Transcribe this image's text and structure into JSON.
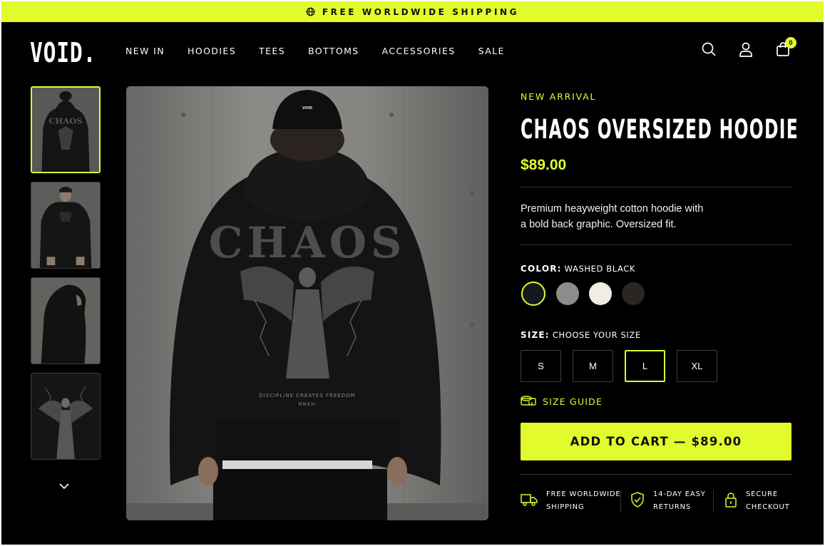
{
  "announcement": {
    "text": "FREE WORLDWIDE SHIPPING",
    "icon": "globe-icon"
  },
  "header": {
    "logo": "VOID.",
    "nav": [
      "NEW IN",
      "HOODIES",
      "TEES",
      "BOTTOMS",
      "ACCESSORIES",
      "SALE"
    ],
    "icons": [
      "search-icon",
      "user-icon",
      "bag-icon"
    ],
    "cart_count": "0"
  },
  "gallery": {
    "thumbnails": [
      "hoodie-back-view",
      "hoodie-front-view",
      "hoodie-side-view",
      "graphic-close-up"
    ],
    "main_graphic": {
      "headline": "CHAOS",
      "tagline": "DISCIPLINE CREATES FREEDOM",
      "year": "MMXXI",
      "cap_label": "VOID"
    }
  },
  "product": {
    "eyebrow": "NEW ARRIVAL",
    "title": "CHAOS OVERSIZED HOODIE",
    "price": "$89.00",
    "description_line1": "Premium heayweight cotton hoodie with",
    "description_line2": "a bold back graphic. Oversized fit.",
    "color_label": "COLOR:",
    "color_value": "WASHED BLACK",
    "colors": [
      {
        "name": "washed-black",
        "hex": "#13181c",
        "selected": true
      },
      {
        "name": "grey",
        "hex": "#8c8c8c",
        "selected": false
      },
      {
        "name": "cream",
        "hex": "#f1ede4",
        "selected": false
      },
      {
        "name": "dark-brown",
        "hex": "#2c2522",
        "selected": false
      }
    ],
    "size_label": "SIZE:",
    "size_value": "CHOOSE YOUR SIZE",
    "sizes": [
      "S",
      "M",
      "L",
      "XL"
    ],
    "selected_size": "L",
    "size_guide": "SIZE GUIDE",
    "add_to_cart": "ADD TO CART — $89.00",
    "features": [
      {
        "icon": "truck-icon",
        "text": "FREE WORLDWIDE\nSHIPPING"
      },
      {
        "icon": "shield-check-icon",
        "text": "14-DAY EASY\nRETURNS"
      },
      {
        "icon": "lock-icon",
        "text": "SECURE\nCHECKOUT"
      }
    ]
  },
  "colors": {
    "accent": "#e1fb2c",
    "background": "#000000",
    "border": "#3e3e3e"
  }
}
